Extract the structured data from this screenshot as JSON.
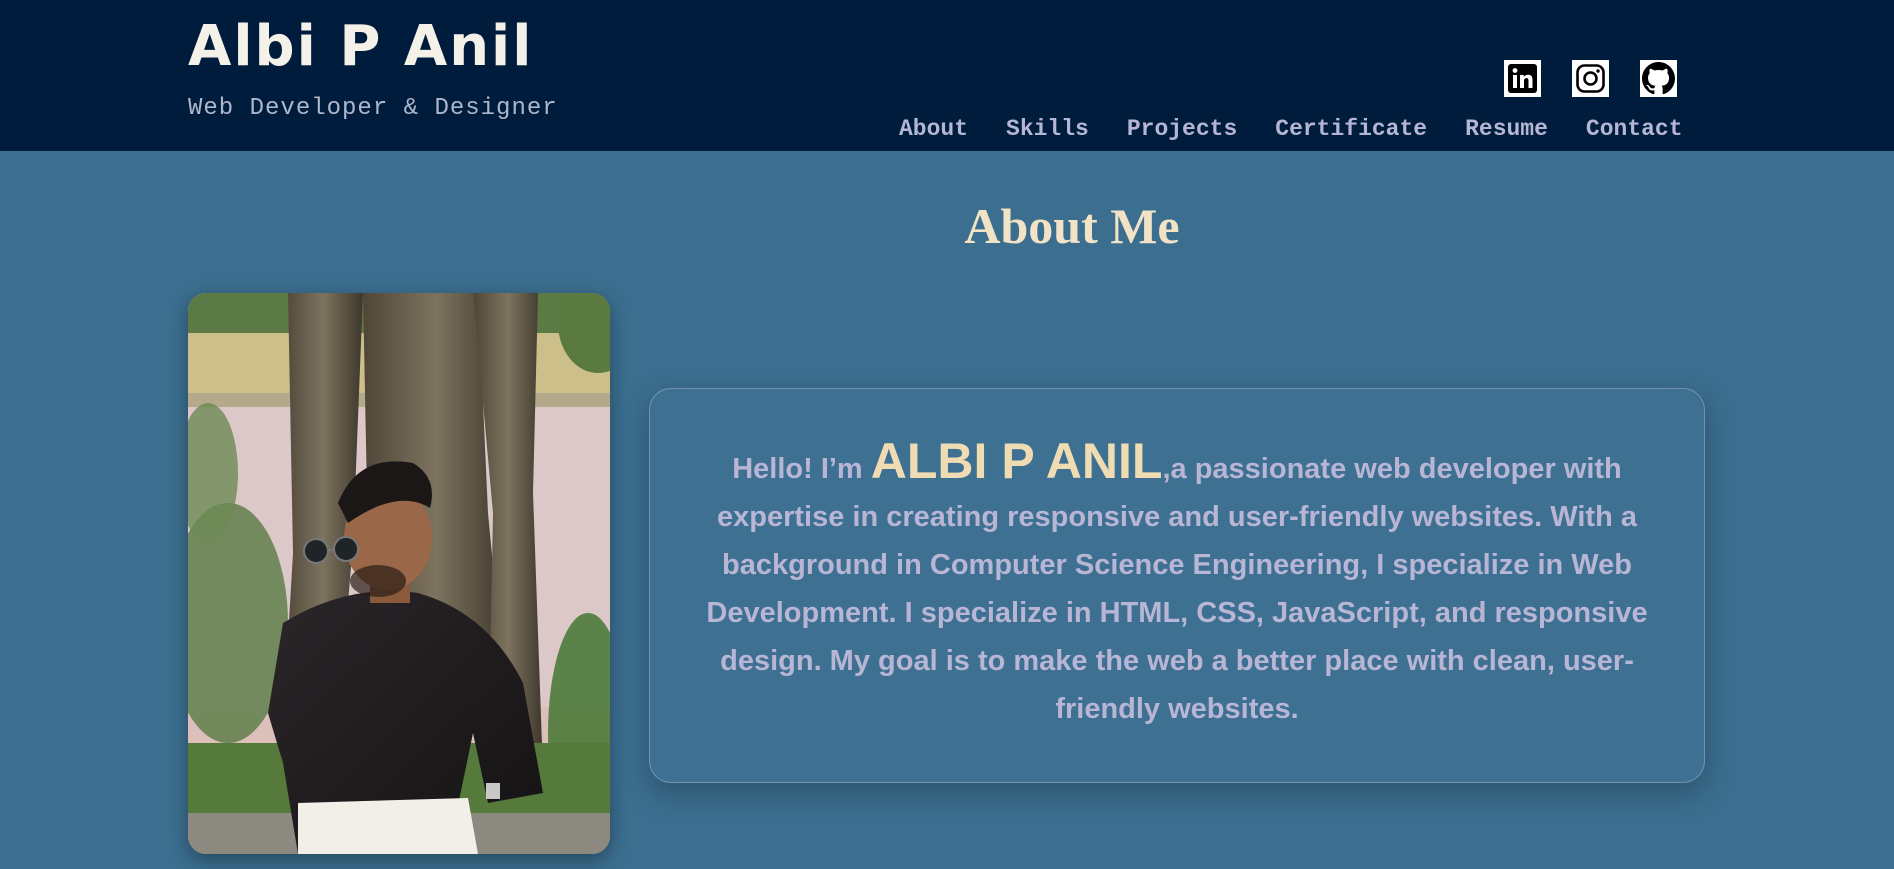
{
  "header": {
    "name": "Albi P Anil",
    "tagline": "Web Developer & Designer",
    "social": [
      {
        "icon": "linkedin-icon",
        "label": "LinkedIn"
      },
      {
        "icon": "instagram-icon",
        "label": "Instagram"
      },
      {
        "icon": "github-icon",
        "label": "GitHub"
      }
    ],
    "nav": [
      "About",
      "Skills",
      "Projects",
      "Certificate",
      "Resume",
      "Contact"
    ]
  },
  "about": {
    "title": "About Me",
    "greeting": "Hello! I’m ",
    "highlight_name": "ALBI P ANIL",
    "bio": ",a passionate web developer with expertise in creating responsive and user-friendly websites. With a background in Computer Science Engineering, I specialize in Web Development. I specialize in HTML, CSS, JavaScript, and responsive design. My goal is to make the web a better place with clean, user-friendly websites."
  },
  "colors": {
    "header_bg": "#001c3d",
    "page_bg": "#3b6e8f",
    "title": "#f2e3c6",
    "nav_text": "#b4b6d4",
    "bio_text": "#b8b5d5",
    "highlight": "#efdcb3"
  }
}
